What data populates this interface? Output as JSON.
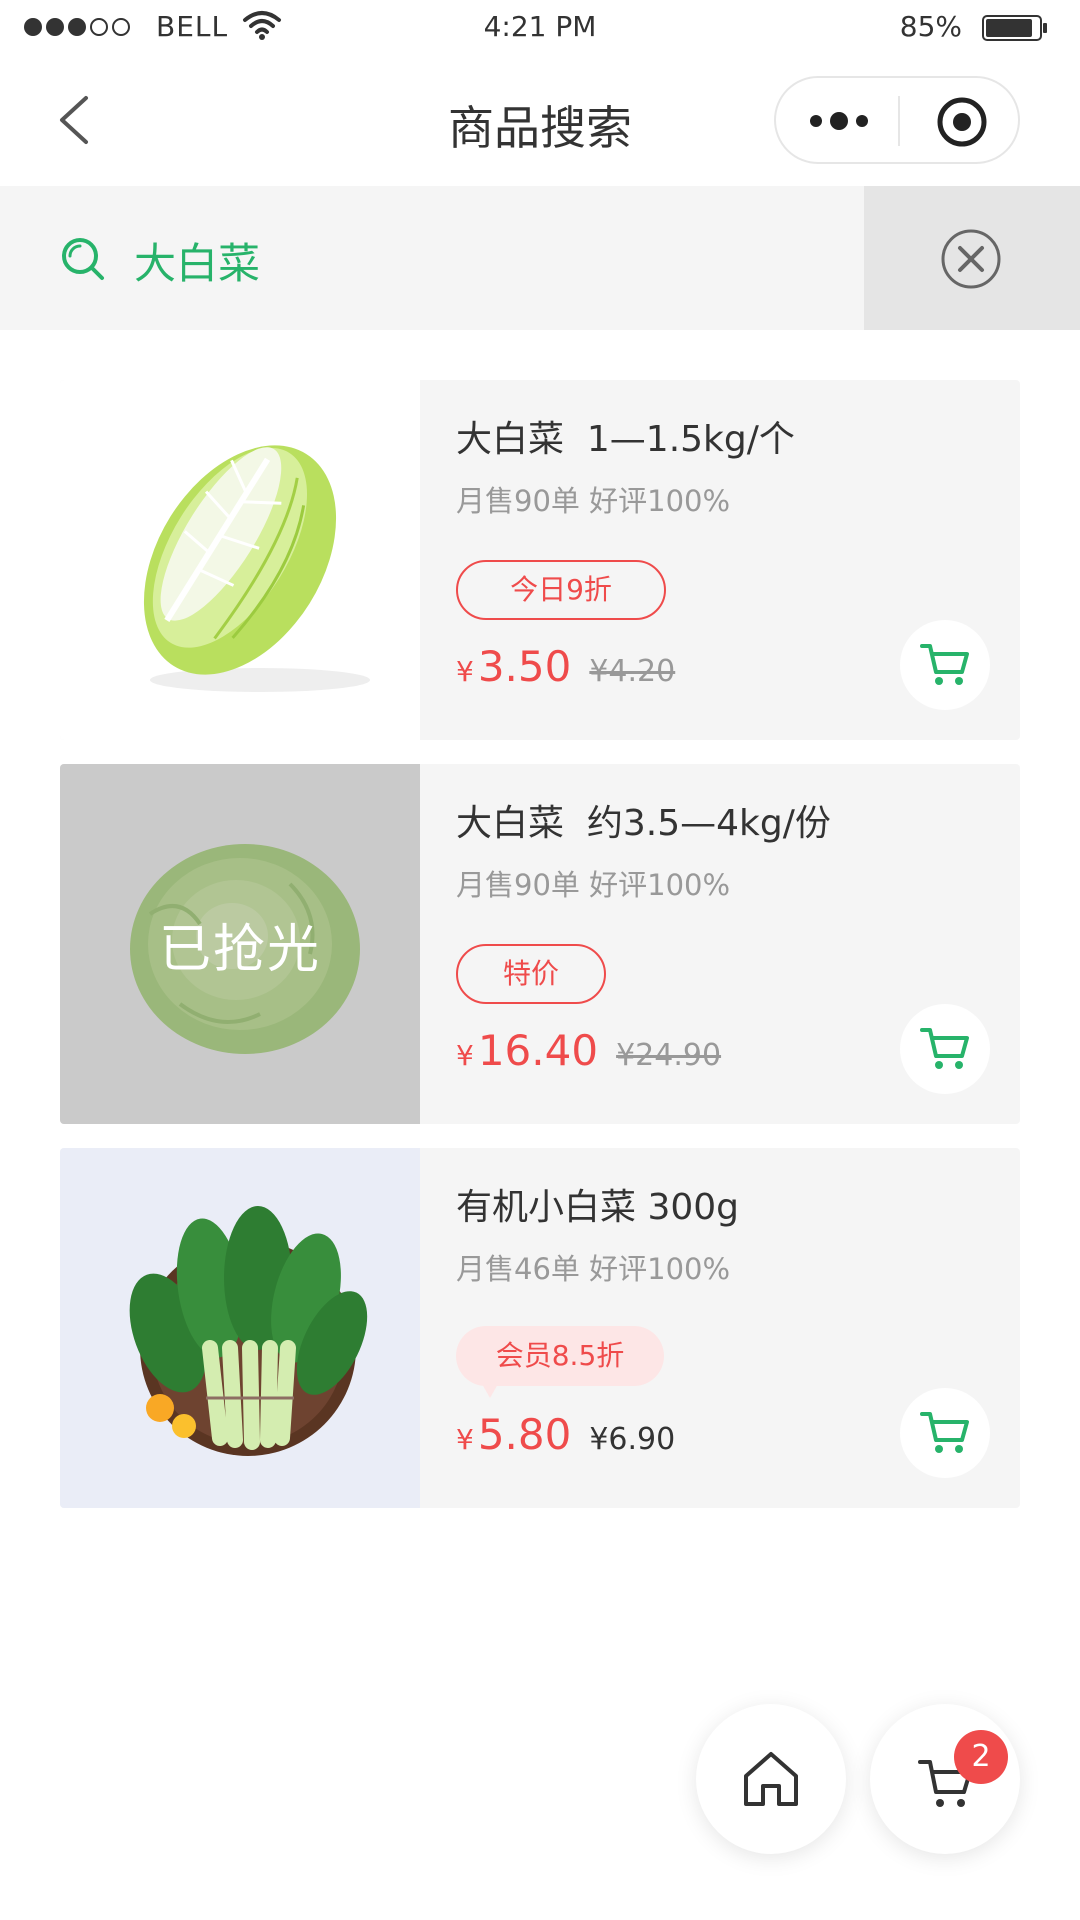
{
  "status_bar": {
    "carrier": "BELL",
    "time": "4:21 PM",
    "battery": "85%"
  },
  "nav": {
    "title": "商品搜索"
  },
  "search": {
    "value": "大白菜"
  },
  "products": [
    {
      "name": "大白菜  1—1.5kg/个",
      "stats": "月售90单 好评100%",
      "tag": "今日9折",
      "currency": "¥",
      "price": "3.50",
      "original_price": "¥4.20",
      "sold_out": ""
    },
    {
      "name": "大白菜  约3.5—4kg/份",
      "stats": "月售90单 好评100%",
      "tag": "特价",
      "currency": "¥",
      "price": "16.40",
      "original_price": "¥24.90",
      "sold_out": "已抢光"
    },
    {
      "name": "有机小白菜 300g",
      "stats": "月售46单 好评100%",
      "tag": "会员8.5折",
      "currency": "¥",
      "price": "5.80",
      "original_price": "¥6.90",
      "sold_out": ""
    }
  ],
  "cart": {
    "count": "2"
  },
  "colors": {
    "accent": "#27b36a",
    "price": "#ef4b4b"
  }
}
